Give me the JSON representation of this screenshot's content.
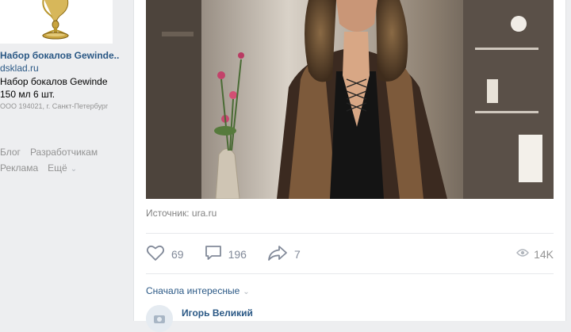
{
  "ad": {
    "title": "Набор бокалов Gewinde...",
    "domain": "dsklad.ru",
    "description": "Набор бокалов Gewinde 150 мл 6 шт.",
    "legal": "ООО 194021, г. Санкт-Петербург"
  },
  "footer": {
    "blog": "Блог",
    "developers": "Разработчикам",
    "ads": "Реклама",
    "more": "Ещё"
  },
  "post": {
    "source_label": "Источник:",
    "source_link": "ura.ru",
    "likes": "69",
    "comments": "196",
    "shares": "7",
    "views": "14K",
    "sort_label": "Сначала интересные",
    "comment_author": "Игорь Великий"
  },
  "colors": {
    "link": "#2a5885",
    "muted": "#828a99",
    "background": "#edeef0"
  }
}
